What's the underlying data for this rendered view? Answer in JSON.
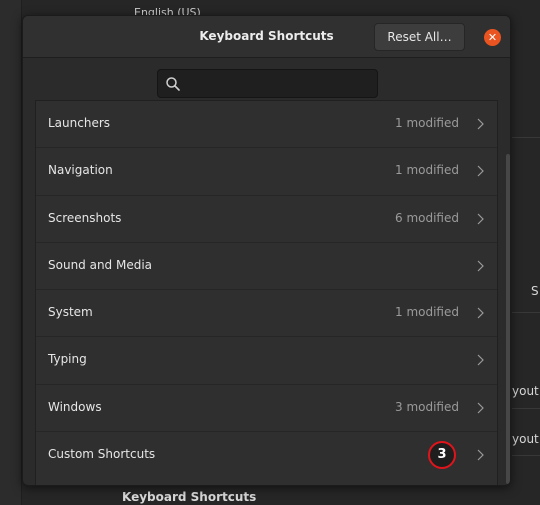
{
  "background": {
    "top_text": "English (US)",
    "right_texts": [
      "S",
      "yout",
      "yout"
    ],
    "bottom_heading": "Keyboard Shortcuts"
  },
  "dialog": {
    "title": "Keyboard Shortcuts",
    "reset_label": "Reset All…",
    "close_icon": "close-icon",
    "search": {
      "placeholder": "",
      "value": "",
      "icon": "search-icon"
    }
  },
  "categories": [
    {
      "label": "Launchers",
      "status": "1 modified"
    },
    {
      "label": "Navigation",
      "status": "1 modified"
    },
    {
      "label": "Screenshots",
      "status": "6 modified"
    },
    {
      "label": "Sound and Media",
      "status": ""
    },
    {
      "label": "System",
      "status": "1 modified"
    },
    {
      "label": "Typing",
      "status": ""
    },
    {
      "label": "Windows",
      "status": "3 modified"
    },
    {
      "label": "Custom Shortcuts",
      "status": ""
    }
  ],
  "annotation": {
    "badge_number": "3"
  },
  "colors": {
    "accent_close": "#e95420",
    "badge_ring": "#e0141b"
  }
}
